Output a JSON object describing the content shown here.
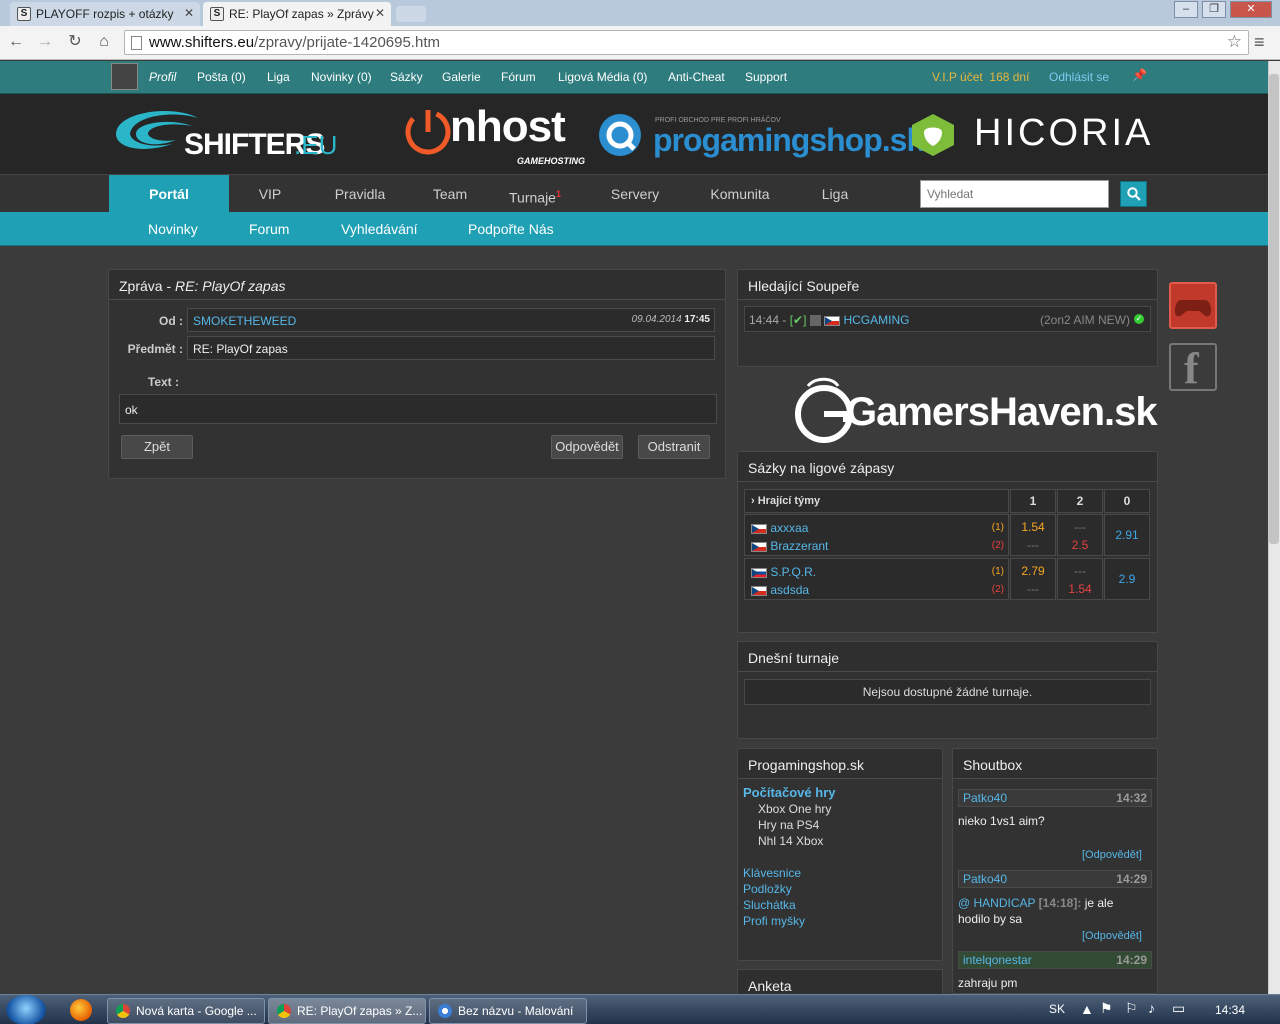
{
  "browser": {
    "tabs": [
      {
        "title": "PLAYOFF rozpis + otázky"
      },
      {
        "title": "RE: PlayOf zapas » Zprávy"
      }
    ],
    "url_host": "www.shifters.eu",
    "url_path": "/zpravy/prijate-1420695.htm"
  },
  "topbar": {
    "links": [
      "Profil",
      "Pošta (0)",
      "Liga",
      "Novinky (0)",
      "Sázky",
      "Galerie",
      "Fórum",
      "Ligová Média (0)",
      "Anti-Cheat",
      "Support"
    ],
    "vip_label": "V.I.P účet",
    "vip_days": "168 dní",
    "logout": "Odhlásit se"
  },
  "banner": {
    "shifters": "SHIFTERS",
    "shifters_tld": ".EU",
    "onhost": "nhost",
    "onhost_sub": "GAMEHOSTING",
    "pgs_small": "PROFI OBCHOD PRE PROFI HRÁČOV",
    "pgs": "progamingshop.sk",
    "hicoria": "HICORIA"
  },
  "mainnav": {
    "items": [
      "Portál",
      "VIP",
      "Pravidla",
      "Team",
      "Turnaje",
      "Servery",
      "Komunita",
      "Liga"
    ],
    "turnaje_badge": "1",
    "search_placeholder": "Vyhledat"
  },
  "subnav": {
    "items": [
      "Novinky",
      "Forum",
      "Vyhledávání",
      "Podpořte Nás"
    ]
  },
  "message": {
    "head_prefix": "Zpráva - ",
    "head_subject": "RE: PlayOf zapas",
    "from_label": "Od :",
    "from_value": "SMOKETHEWEED",
    "date": "09.04.2014",
    "time": "17:45",
    "subject_label": "Předmět :",
    "subject_value": "RE: PlayOf zapas",
    "text_label": "Text :",
    "text_value": "ok",
    "back": "Zpět",
    "reply": "Odpovědět",
    "delete": "Odstranit"
  },
  "opponents": {
    "title": "Hledající Soupeře",
    "time": "14:44 -",
    "check": "[✔]",
    "team": "HCGAMING",
    "mode": "(2on2 AIM NEW)"
  },
  "gamershaven": "GamersHaven.sk",
  "bets": {
    "title": "Sázky na ligové zápasy",
    "header_teams": "Hrající týmy",
    "header_cols": [
      "1",
      "2",
      "0"
    ],
    "matches": [
      {
        "team1": "axxxaa",
        "team2": "Brazzerant",
        "tag1": "(1)",
        "tag2": "(2)",
        "odd1": "1.54",
        "odd2": "2.5",
        "odd0": "2.91"
      },
      {
        "team1": "S.P.Q.R.",
        "team2": "asdsda",
        "tag1": "(1)",
        "tag2": "(2)",
        "odd1": "2.79",
        "odd2": "1.54",
        "odd0": "2.9"
      }
    ],
    "dash": "---"
  },
  "tournaments": {
    "title": "Dnešní turnaje",
    "empty": "Nejsou dostupné žádné turnaje."
  },
  "shop": {
    "title": "Progamingshop.sk",
    "category": "Počítačové hry",
    "sub_items": [
      "Xbox One hry",
      "Hry na PS4",
      "Nhl 14 Xbox"
    ],
    "links": [
      "Klávesnice",
      "Podložky",
      "Sluchátka",
      "Profi myšky"
    ]
  },
  "shoutbox": {
    "title": "Shoutbox",
    "reply": "[Odpovědět]",
    "posts": [
      {
        "user": "Patko40",
        "time": "14:32",
        "text": "nieko 1vs1 aim?"
      },
      {
        "user": "Patko40",
        "time": "14:29",
        "mention": "@ HANDICAP",
        "mention_time": "[14:18]:",
        "text": "je ale",
        "text2": "hodilo by sa"
      },
      {
        "user": "intelqonestar",
        "time": "14:29",
        "text": "zahraju pm"
      }
    ]
  },
  "poll": {
    "title": "Anketa"
  },
  "taskbar": {
    "tasks": [
      "Nová karta - Google ...",
      "RE: PlayOf zapas » Z...",
      "Bez názvu - Malování"
    ],
    "lang": "SK",
    "clock": "14:34"
  }
}
